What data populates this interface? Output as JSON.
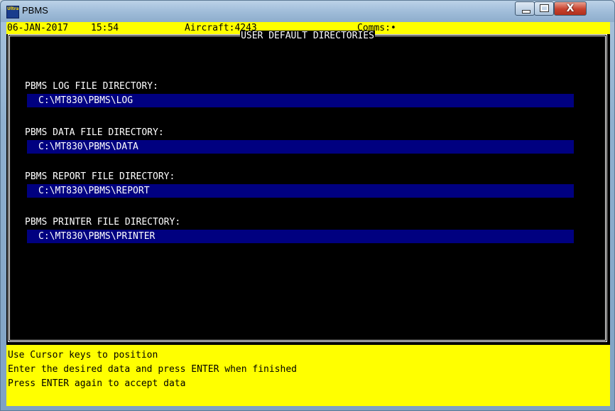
{
  "window": {
    "title": "PBMS",
    "app_icon_text": "Ultra",
    "controls": {
      "close_glyph": "X"
    }
  },
  "status_bar": {
    "date": "06-JAN-2017",
    "time": "15:54",
    "aircraft": "Aircraft:4243",
    "comms": "Comms:•"
  },
  "panel": {
    "title": "USER DEFAULT DIRECTORIES",
    "fields": [
      {
        "label": "PBMS LOG FILE DIRECTORY:",
        "value": "C:\\MT830\\PBMS\\LOG"
      },
      {
        "label": "PBMS DATA FILE DIRECTORY:",
        "value": "C:\\MT830\\PBMS\\DATA"
      },
      {
        "label": "PBMS REPORT FILE DIRECTORY:",
        "value": "C:\\MT830\\PBMS\\REPORT"
      },
      {
        "label": "PBMS PRINTER FILE DIRECTORY:",
        "value": "C:\\MT830\\PBMS\\PRINTER"
      }
    ]
  },
  "help": [
    "Use Cursor keys to position",
    "Enter the desired data and press ENTER when finished",
    "Press ENTER again to accept data"
  ],
  "colors": {
    "status_bg": "#ffff00",
    "field_bg": "#000080",
    "screen_bg": "#000000"
  }
}
